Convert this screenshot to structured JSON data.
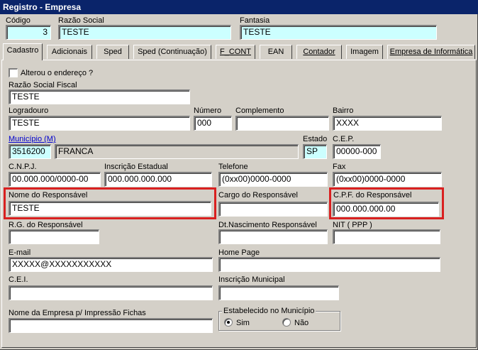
{
  "window": {
    "title": "Registro - Empresa"
  },
  "header": {
    "codigo_label": "Código",
    "codigo_value": "3",
    "razao_social_label": "Razão Social",
    "razao_social_value": "TESTE",
    "fantasia_label": "Fantasia",
    "fantasia_value": "TESTE"
  },
  "tabs": [
    {
      "label": "Cadastro",
      "active": true
    },
    {
      "label": "Adicionais"
    },
    {
      "label": "Sped"
    },
    {
      "label": "Sped (Continuação)"
    },
    {
      "label": "F_CONT"
    },
    {
      "label": "EAN"
    },
    {
      "label": "Contador"
    },
    {
      "label": "Imagem"
    },
    {
      "label": "Empresa de Informática"
    }
  ],
  "form": {
    "alterou_endereco": {
      "label": "Alterou o endereço ?",
      "checked": false
    },
    "razao_social_fiscal": {
      "label": "Razão Social Fiscal",
      "value": "TESTE"
    },
    "logradouro": {
      "label": "Logradouro",
      "value": "TESTE"
    },
    "numero": {
      "label": "Número",
      "value": "000"
    },
    "complemento": {
      "label": "Complemento",
      "value": ""
    },
    "bairro": {
      "label": "Bairro",
      "value": "XXXX"
    },
    "municipio": {
      "label": "Município (M)",
      "code": "3516200",
      "name": "FRANCA"
    },
    "estado": {
      "label": "Estado",
      "value": "SP"
    },
    "cep": {
      "label": "C.E.P.",
      "value": "00000-000"
    },
    "cnpj": {
      "label": "C.N.P.J.",
      "value": "00.000.000/0000-00"
    },
    "inscricao_estadual": {
      "label": "Inscrição Estadual",
      "value": "000.000.000.000"
    },
    "telefone": {
      "label": "Telefone",
      "value": "(0xx00)0000-0000"
    },
    "fax": {
      "label": "Fax",
      "value": "(0xx00)0000-0000"
    },
    "nome_responsavel": {
      "label": "Nome do Responsável",
      "value": "TESTE"
    },
    "cargo_responsavel": {
      "label": "Cargo do Responsável",
      "value": ""
    },
    "cpf_responsavel": {
      "label": "C.P.F. do Responsável",
      "value": "000.000.000.00"
    },
    "rg_responsavel": {
      "label": "R.G. do Responsável",
      "value": ""
    },
    "dt_nascimento": {
      "label": "Dt.Nascimento Responsável",
      "value": ""
    },
    "nit": {
      "label": "NIT ( PPP )",
      "value": ""
    },
    "email": {
      "label": "E-mail",
      "value": "XXXXX@XXXXXXXXXXX"
    },
    "home_page": {
      "label": "Home Page",
      "value": ""
    },
    "cei": {
      "label": "C.E.I.",
      "value": ""
    },
    "inscricao_municipal": {
      "label": "Inscrição Municipal",
      "value": ""
    },
    "nome_impressao": {
      "label": "Nome da Empresa p/ Impressão Fichas",
      "value": ""
    },
    "estabelecido": {
      "label": "Estabelecido no Município",
      "options": [
        "Sim",
        "Não"
      ],
      "selected": "Sim"
    }
  },
  "colors": {
    "titlebar": "#0a246a",
    "highlight_box": "#d92020",
    "cyan_field": "#ccffff"
  }
}
